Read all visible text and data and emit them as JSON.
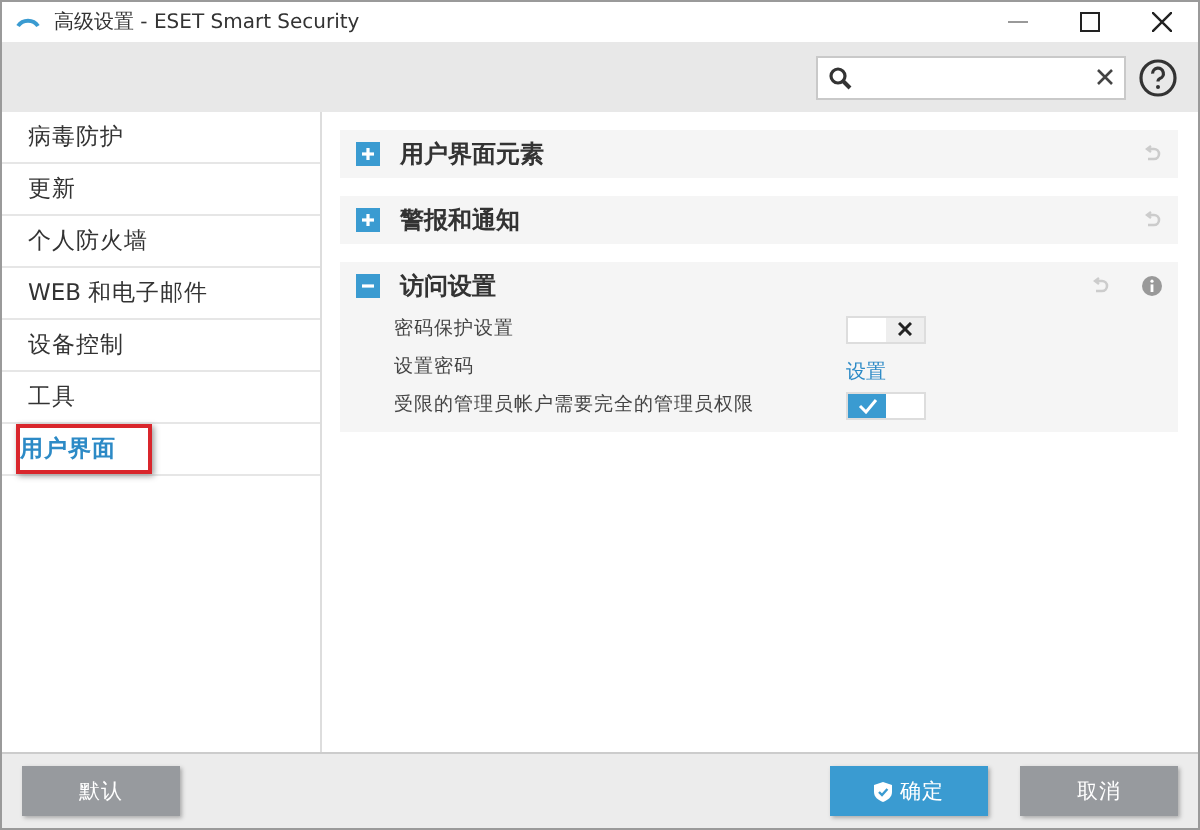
{
  "window": {
    "title": "高级设置 - ESET Smart Security"
  },
  "sidebar": {
    "items": [
      {
        "label": "病毒防护",
        "selected": false
      },
      {
        "label": "更新",
        "selected": false
      },
      {
        "label": "个人防火墙",
        "selected": false
      },
      {
        "label": "WEB 和电子邮件",
        "selected": false
      },
      {
        "label": "设备控制",
        "selected": false
      },
      {
        "label": "工具",
        "selected": false
      },
      {
        "label": "用户界面",
        "selected": true
      }
    ]
  },
  "sections": [
    {
      "title": "用户界面元素",
      "expanded": false,
      "info": false
    },
    {
      "title": "警报和通知",
      "expanded": false,
      "info": false
    },
    {
      "title": "访问设置",
      "expanded": true,
      "info": true,
      "rows": [
        {
          "label": "密码保护设置",
          "kind": "toggle",
          "on": false
        },
        {
          "label": "设置密码",
          "kind": "link",
          "link": "设置"
        },
        {
          "label": "受限的管理员帐户需要完全的管理员权限",
          "kind": "toggle",
          "on": true
        }
      ]
    }
  ],
  "buttons": [
    {
      "label": "默认",
      "kind": "plain"
    },
    {
      "label": "确定",
      "kind": "primary"
    },
    {
      "label": "取消",
      "kind": "plain"
    }
  ]
}
